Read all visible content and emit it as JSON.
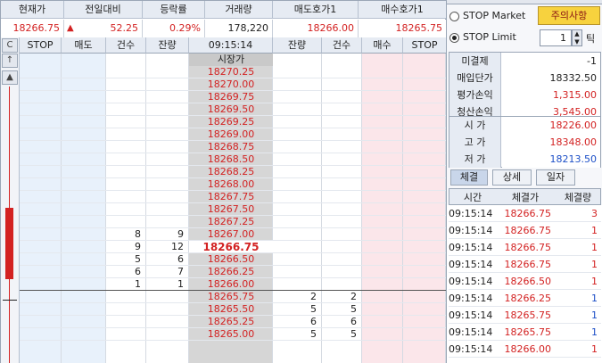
{
  "summary": {
    "headers": [
      "현재가",
      "전일대비",
      "등락률",
      "거래량",
      "매도호가1",
      "매수호가1"
    ],
    "current_price": "18266.75",
    "change_icon": "up-triangle-icon",
    "change": "52.25",
    "change_rate": "0.29%",
    "volume": "178,220",
    "ask1": "18266.00",
    "bid1": "18265.75"
  },
  "book": {
    "headers": [
      "STOP",
      "매도",
      "건수",
      "잔량",
      "09:15:14",
      "잔량",
      "건수",
      "매수",
      "STOP"
    ],
    "open_label": "시장가",
    "current_price": "18266.75",
    "sell_rows": [
      {
        "price": "18270.25",
        "count": "",
        "qty": ""
      },
      {
        "price": "18270.00",
        "count": "",
        "qty": ""
      },
      {
        "price": "18269.75",
        "count": "",
        "qty": ""
      },
      {
        "price": "18269.50",
        "count": "",
        "qty": ""
      },
      {
        "price": "18269.25",
        "count": "",
        "qty": ""
      },
      {
        "price": "18269.00",
        "count": "",
        "qty": ""
      },
      {
        "price": "18268.75",
        "count": "",
        "qty": ""
      },
      {
        "price": "18268.50",
        "count": "",
        "qty": ""
      },
      {
        "price": "18268.25",
        "count": "",
        "qty": ""
      },
      {
        "price": "18268.00",
        "count": "",
        "qty": ""
      },
      {
        "price": "18267.75",
        "count": "",
        "qty": ""
      },
      {
        "price": "18267.50",
        "count": "",
        "qty": ""
      },
      {
        "price": "18267.25",
        "count": "",
        "qty": ""
      },
      {
        "price": "18267.00",
        "count": "8",
        "qty": "9"
      }
    ],
    "mid_rows": [
      {
        "price": "18266.50",
        "count": "5",
        "qty": "6"
      },
      {
        "price": "18266.25",
        "count": "6",
        "qty": "7"
      },
      {
        "price": "18266.00",
        "count": "1",
        "qty": "1"
      }
    ],
    "current_row": {
      "count": "9",
      "qty": "12"
    },
    "buy_rows": [
      {
        "price": "18265.75",
        "qty": "2",
        "count": "2"
      },
      {
        "price": "18265.50",
        "qty": "5",
        "count": "5"
      },
      {
        "price": "18265.25",
        "qty": "6",
        "count": "6"
      },
      {
        "price": "18265.00",
        "qty": "5",
        "count": "5"
      }
    ],
    "strip_buttons": [
      "C",
      "↑",
      "▲"
    ]
  },
  "right": {
    "stop_market_label": "STOP Market",
    "warning_button": "주의사항",
    "stop_limit_label": "STOP Limit",
    "tick_value": "1",
    "tick_label": "틱",
    "position": [
      {
        "key": "미결제",
        "value": "-1",
        "color": "#222222"
      },
      {
        "key": "매입단가",
        "value": "18332.50",
        "color": "#222222"
      },
      {
        "key": "평가손익",
        "value": "1,315.00",
        "color": "#d32222"
      },
      {
        "key": "청산손익",
        "value": "3,545.00",
        "color": "#d32222"
      }
    ],
    "prices": [
      {
        "key": "시  가",
        "value": "18226.00",
        "color": "#d32222"
      },
      {
        "key": "고  가",
        "value": "18348.00",
        "color": "#d32222"
      },
      {
        "key": "저  가",
        "value": "18213.50",
        "color": "#1c4fc7"
      }
    ],
    "tabs": [
      "체결",
      "상세",
      "일자"
    ],
    "trade_headers": [
      "시간",
      "체결가",
      "체결량"
    ],
    "trades": [
      {
        "time": "09:15:14",
        "price": "18266.75",
        "qty": "3",
        "qcolor": "#d32222"
      },
      {
        "time": "09:15:14",
        "price": "18266.75",
        "qty": "1",
        "qcolor": "#d32222"
      },
      {
        "time": "09:15:14",
        "price": "18266.75",
        "qty": "1",
        "qcolor": "#d32222"
      },
      {
        "time": "09:15:14",
        "price": "18266.75",
        "qty": "1",
        "qcolor": "#d32222"
      },
      {
        "time": "09:15:14",
        "price": "18266.50",
        "qty": "1",
        "qcolor": "#d32222"
      },
      {
        "time": "09:15:14",
        "price": "18266.25",
        "qty": "1",
        "qcolor": "#1c4fc7"
      },
      {
        "time": "09:15:14",
        "price": "18265.75",
        "qty": "1",
        "qcolor": "#1c4fc7"
      },
      {
        "time": "09:15:14",
        "price": "18265.75",
        "qty": "1",
        "qcolor": "#1c4fc7"
      },
      {
        "time": "09:15:14",
        "price": "18266.00",
        "qty": "1",
        "qcolor": "#d32222"
      }
    ]
  },
  "colors": {
    "sell_bg": "#e8f1fb",
    "buy_bg": "#fbe6ea",
    "price_bg": "#d6d6d6",
    "up": "#d32222",
    "down": "#1c4fc7",
    "accent_button": "#f7d23e"
  }
}
